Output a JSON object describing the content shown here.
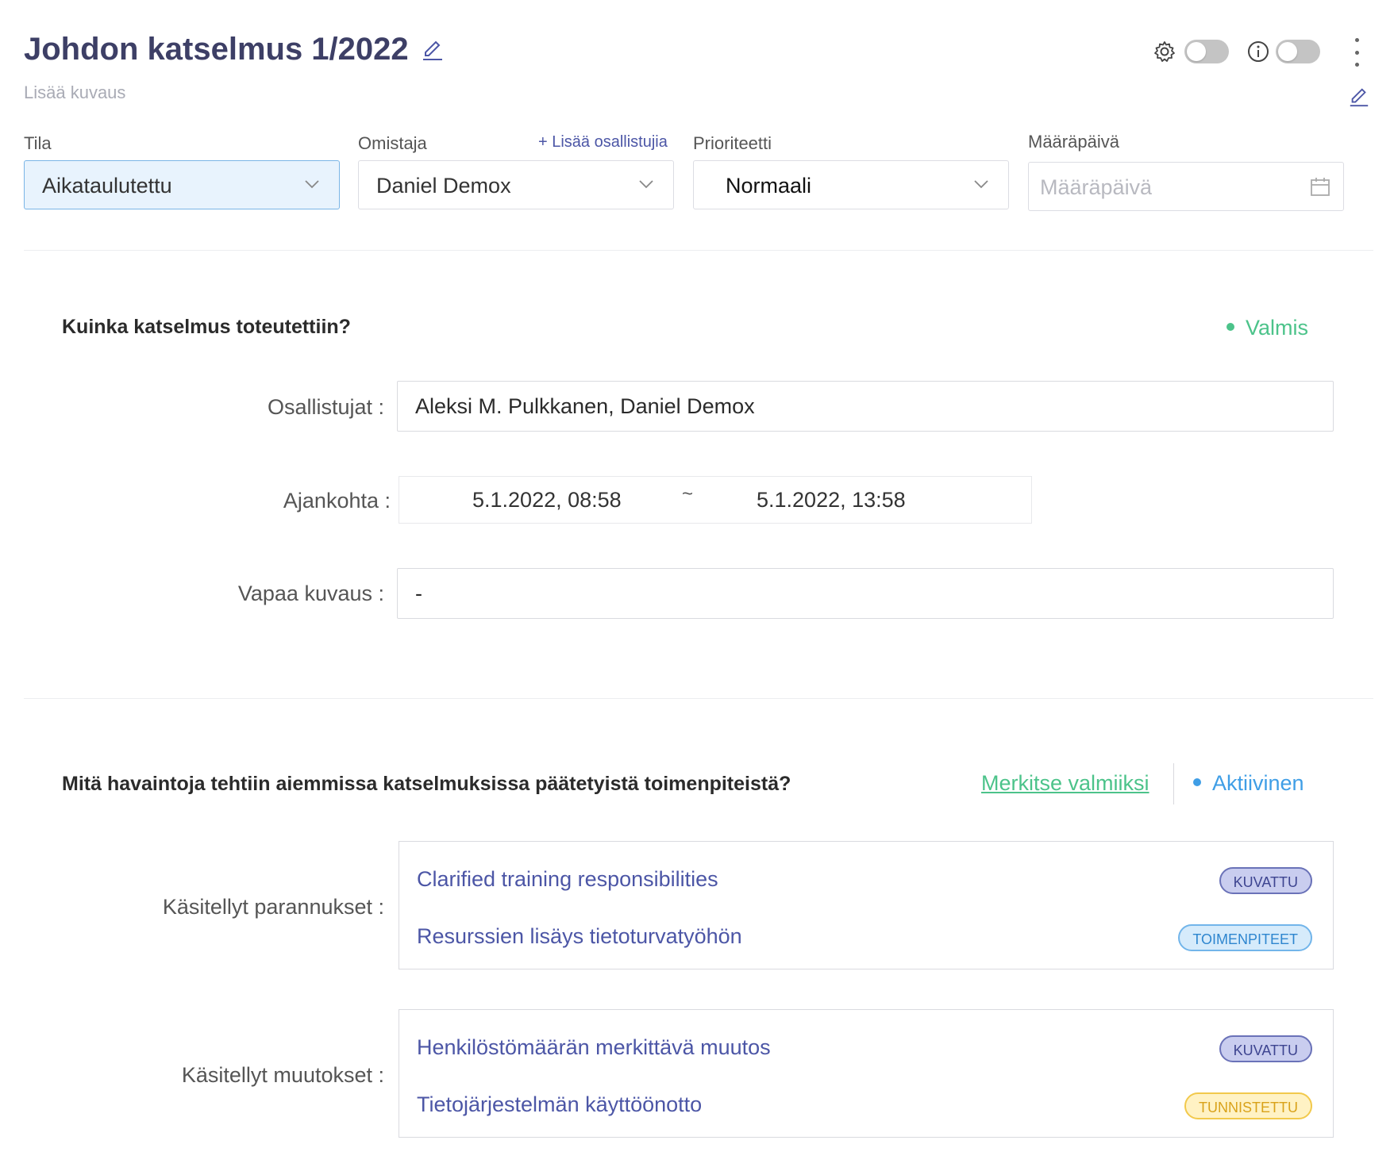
{
  "header": {
    "title": "Johdon katselmus 1/2022",
    "description_placeholder": "Lisää kuvaus",
    "icons": [
      "pencil-icon",
      "gear-icon",
      "info-icon",
      "kebab-menu-icon"
    ]
  },
  "fields": {
    "status": {
      "label": "Tila",
      "value": "Aikataulutettu"
    },
    "owner": {
      "label": "Omistaja",
      "value": "Daniel Demox",
      "add_participants": "+ Lisää osallistujia"
    },
    "priority": {
      "label": "Prioriteetti",
      "value": "Normaali"
    },
    "due_date": {
      "label": "Määräpäivä",
      "placeholder": "Määräpäivä"
    }
  },
  "section1": {
    "title": "Kuinka katselmus toteutettiin?",
    "status": "Valmis",
    "participants": {
      "label": "Osallistujat :",
      "value": "Aleksi M. Pulkkanen, Daniel Demox"
    },
    "timing": {
      "label": "Ajankohta :",
      "start": "5.1.2022, 08:58",
      "separator": "~",
      "end": "5.1.2022, 13:58"
    },
    "free_description": {
      "label": "Vapaa kuvaus :",
      "value": "-"
    }
  },
  "section2": {
    "title": "Mitä havaintoja tehtiin aiemmissa katselmuksissa päätetyistä toimenpiteistä?",
    "mark_done": "Merkitse valmiiksi",
    "status": "Aktiivinen",
    "improvements": {
      "label": "Käsitellyt parannukset :",
      "items": [
        {
          "title": "Clarified training responsibilities",
          "badge": "KUVATTU"
        },
        {
          "title": "Resurssien lisäys tietoturvatyöhön",
          "badge": "TOIMENPITEET"
        }
      ]
    },
    "changes": {
      "label": "Käsitellyt muutokset :",
      "items": [
        {
          "title": "Henkilöstömäärän merkittävä muutos",
          "badge": "KUVATTU"
        },
        {
          "title": "Tietojärjestelmän käyttöönotto",
          "badge": "TUNNISTETTU"
        }
      ]
    }
  },
  "colors": {
    "title": "#3d3f66",
    "link": "#4c56a6",
    "done_green": "#4cc38a",
    "active_blue": "#3f9ee6"
  }
}
